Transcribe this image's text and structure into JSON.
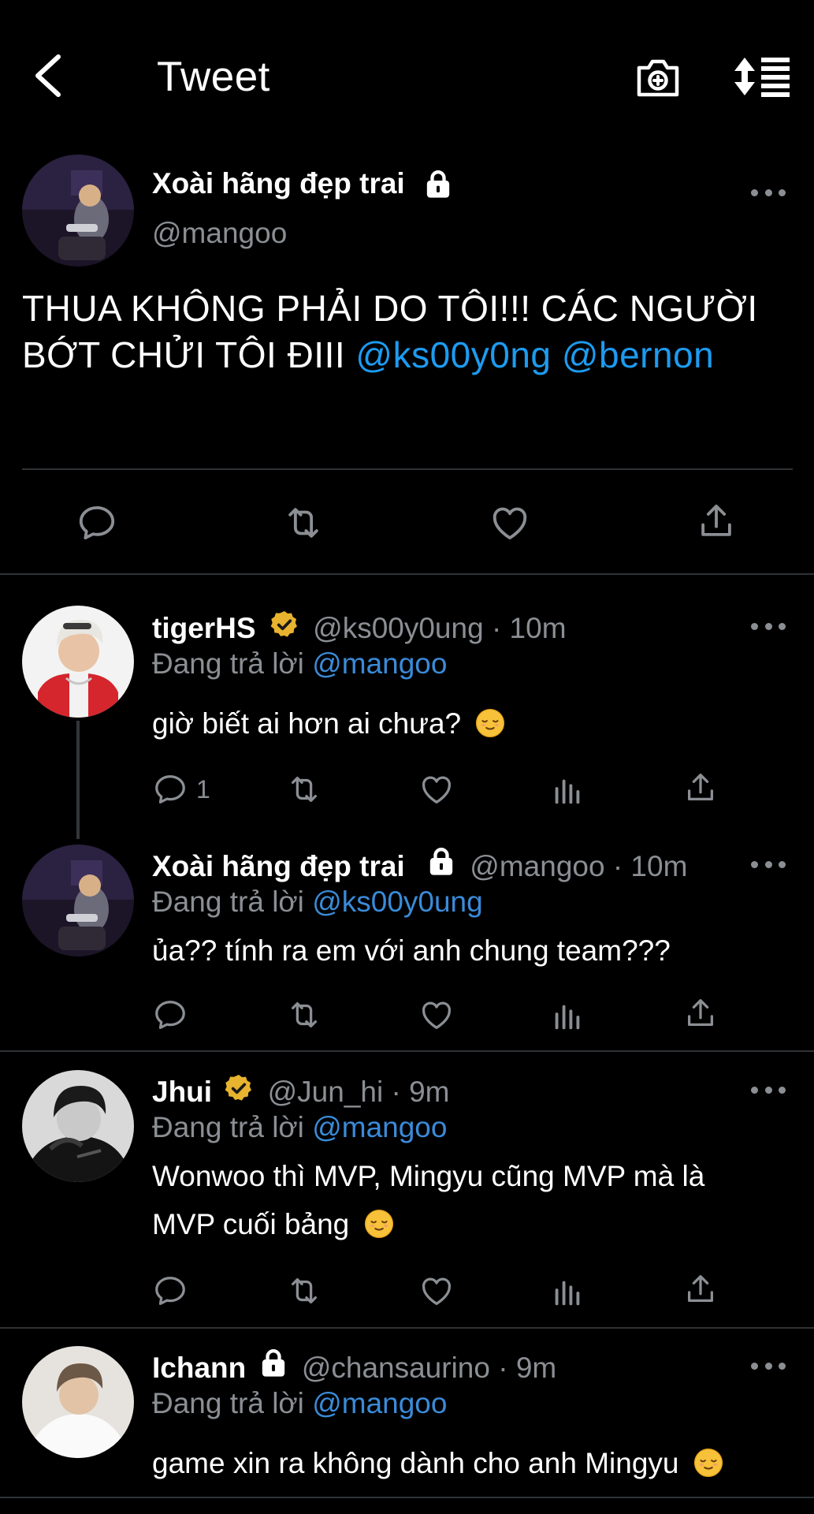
{
  "header": {
    "title": "Tweet"
  },
  "main_tweet": {
    "author_name": "Xoài hãng đẹp trai",
    "author_handle": "@mangoo",
    "text_plain": "THUA KHÔNG PHẢI DO TÔI!!! CÁC NGƯỜI BỚT CHỬI TÔI ĐIII",
    "mentions": [
      "@ks00y0ng",
      "@bernon"
    ]
  },
  "replies": [
    {
      "name": "tigerHS",
      "verified": true,
      "meta": "@ks00y0ung · 10m",
      "replying_label": "Đang trả lời",
      "replying_to": "@mangoo",
      "text": "giờ biết ai hơn ai chưa?",
      "reply_count": "1"
    },
    {
      "name": "Xoài hãng đẹp trai",
      "locked": true,
      "meta": "@mangoo · 10m",
      "replying_label": "Đang trả lời",
      "replying_to": "@ks00y0ung",
      "text": "ủa?? tính ra em với anh chung team???"
    },
    {
      "name": "Jhui",
      "verified": true,
      "meta": "@Jun_hi · 9m",
      "replying_label": "Đang trả lời",
      "replying_to": "@mangoo",
      "text_line1": "Wonwoo thì MVP, Mingyu cũng MVP mà là",
      "text_line2": "MVP cuối bảng"
    },
    {
      "name": "Ichann",
      "locked": true,
      "meta": "@chansaurino · 9m",
      "replying_label": "Đang trả lời",
      "replying_to": "@mangoo",
      "text": "game xin ra không dành cho anh Mingyu"
    }
  ],
  "colors": {
    "background": "#000000",
    "link": "#1d9bf0",
    "muted": "#8b8f94",
    "verified": "#e8b32e",
    "divider": "#2f3336"
  },
  "icons": [
    "back-arrow-icon",
    "camera-plus-icon",
    "sort-icon",
    "lock-icon",
    "verified-icon",
    "reply-icon",
    "retweet-icon",
    "like-icon",
    "analytics-icon",
    "share-icon",
    "more-icon",
    "relieved-face-emoji"
  ]
}
